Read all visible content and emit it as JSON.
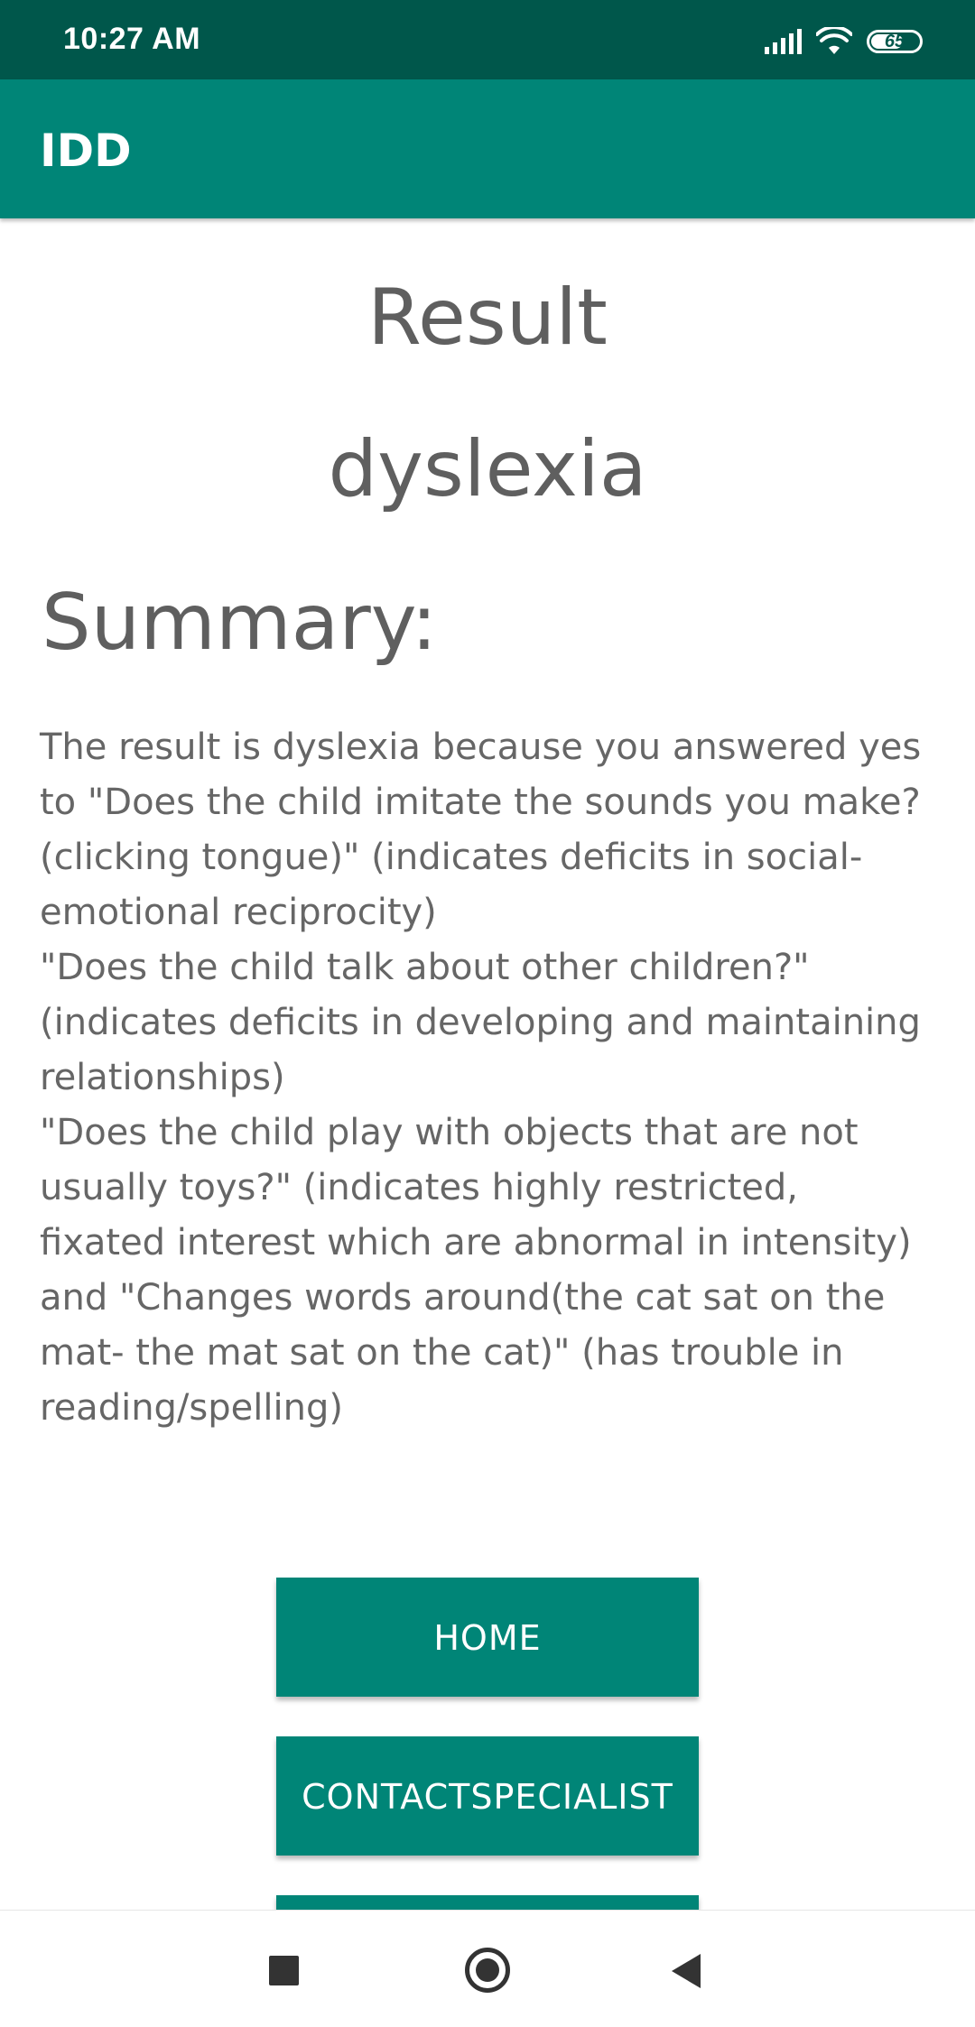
{
  "status_bar": {
    "time": "10:27 AM",
    "battery_level": "65",
    "icons": [
      "signal-icon",
      "wifi-icon",
      "battery-icon"
    ],
    "background_color": "#00574b"
  },
  "app_bar": {
    "title": "IDD",
    "background_color": "#008577"
  },
  "result": {
    "title": "Result",
    "value": "dyslexia"
  },
  "summary": {
    "heading": "Summary:",
    "text": "The result is dyslexia because you answered yes to \"Does the child imitate the sounds you make?(clicking tongue)\" (indicates deficits in social-emotional reciprocity)\n\"Does the child talk about other children?\" (indicates deficits in developing and maintaining relationships)\n\"Does the child play with objects that are not usually toys?\" (indicates highly restricted, fixated interest which are abnormal in intensity)\nand \"Changes words around(the cat sat on the mat- the mat sat on the cat)\" (has trouble in reading/spelling)"
  },
  "buttons": {
    "home_label": "HOME",
    "contact_label": "CONTACTSPECIALIST",
    "color": "#008577"
  },
  "nav_bar": {
    "icons": [
      "recents-icon",
      "home-icon",
      "back-icon"
    ]
  }
}
